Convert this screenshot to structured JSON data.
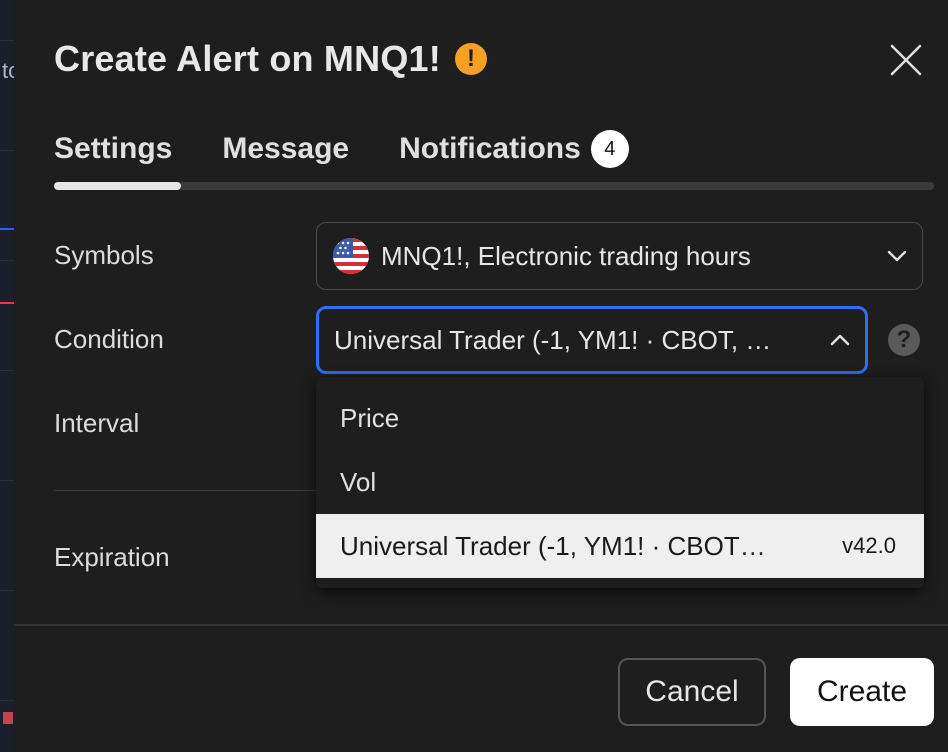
{
  "dialog": {
    "title": "Create Alert on MNQ1!",
    "warning_glyph": "!",
    "close_glyph": "close-icon"
  },
  "tabs": [
    {
      "label": "Settings",
      "active": true
    },
    {
      "label": "Message",
      "active": false
    },
    {
      "label": "Notifications",
      "active": false,
      "badge": "4"
    }
  ],
  "form": {
    "symbols": {
      "label": "Symbols",
      "value": "MNQ1!, Electronic trading hours",
      "icon": "us-flag-icon"
    },
    "condition": {
      "label": "Condition",
      "value": "Universal Trader (-1, YM1! · CBOT, …",
      "help_glyph": "?"
    },
    "interval": {
      "label": "Interval"
    },
    "expiration": {
      "label": "Expiration"
    }
  },
  "condition_dropdown": {
    "options": [
      {
        "label": "Price",
        "selected": false
      },
      {
        "label": "Vol",
        "selected": false
      },
      {
        "label": "Universal Trader (-1, YM1! · CBOT…",
        "version": "v42.0",
        "selected": true
      }
    ]
  },
  "footer": {
    "cancel_label": "Cancel",
    "create_label": "Create"
  },
  "background": {
    "partial_text": "tc"
  },
  "colors": {
    "accent_blue": "#2f6ef5",
    "warning_orange": "#f59f24",
    "dialog_bg": "#1e1e1e"
  }
}
